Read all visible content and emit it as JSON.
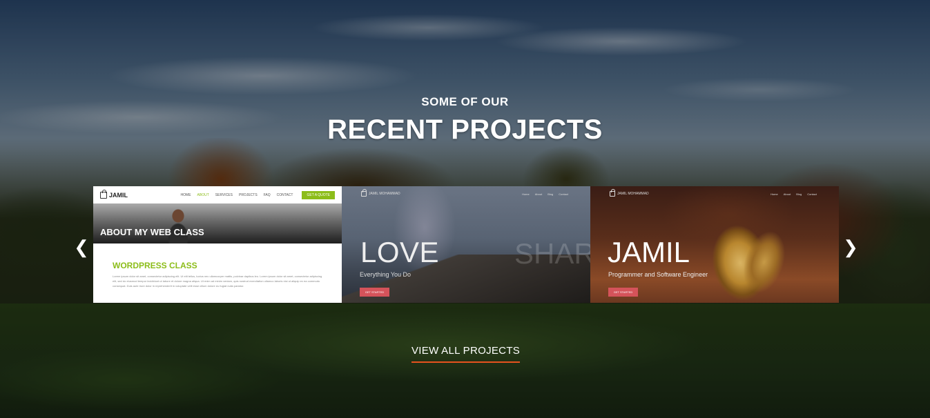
{
  "section": {
    "kicker": "SOME OF OUR",
    "title": "RECENT PROJECTS",
    "view_all": "VIEW ALL PROJECTS",
    "accent_color": "#e8531e"
  },
  "carousel": {
    "prev_icon": "chevron-left-icon",
    "next_icon": "chevron-right-icon",
    "slides": [
      {
        "logo": "JAMIL",
        "menu": [
          "HOME",
          "ABOUT",
          "SERVICES",
          "PROJECTS",
          "FAQ",
          "CONTACT"
        ],
        "button": "GET A QUOTE",
        "hero_title": "ABOUT MY WEB CLASS",
        "section_title": "WORDPRESS CLASS",
        "paragraph": "Lorem ipsum dolor sit amet, consectetur adipiscing elit. Ut elit tellus, luctus nec ullamcorper mattis, pulvinar dapibus leo. Lorem ipsum dolor sit amet, consectetur adipiscing elit, sed do eiusmod tempor incididunt ut labore et dolore magna aliqua. Ut enim ad minim veniam, quis nostrud exercitation ullamco laboris nisi ut aliquip ex ea commodo consequat. Duis aute irure dolor in reprehenderit in voluptate velit esse cillum dolore eu fugiat nulla pariatur.",
        "accent_color": "#8cbd1a"
      },
      {
        "logo": "JAMIL MOHAMMAD",
        "menu": [
          "Home",
          "About",
          "Blog",
          "Contact"
        ],
        "headline": "LOVE",
        "ghost_text": "SHAR",
        "subtitle": "Everything You Do",
        "button": "GET STARTED",
        "accent_color": "#d5535a"
      },
      {
        "logo": "JAMIL MOHAMMAD",
        "menu": [
          "Home",
          "About",
          "Blog",
          "Contact"
        ],
        "headline": "JAMIL",
        "subtitle": "Programmer and Software Engineer",
        "button": "GET STARTED",
        "accent_color": "#d5535a"
      }
    ]
  }
}
